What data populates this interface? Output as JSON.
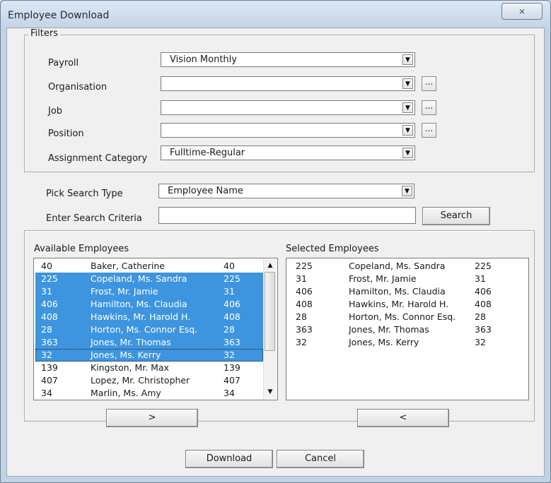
{
  "window": {
    "title": "Employee Download",
    "close_label": "⨯"
  },
  "filters": {
    "legend": "Filters",
    "payroll": {
      "label": "Payroll",
      "value": "Vision Monthly"
    },
    "organisation": {
      "label": "Organisation",
      "value": ""
    },
    "job": {
      "label": "Job",
      "value": ""
    },
    "position": {
      "label": "Position",
      "value": ""
    },
    "assignment_category": {
      "label": "Assignment Category",
      "value": "Fulltime-Regular"
    },
    "ellipsis_label": "..."
  },
  "search": {
    "type_label": "Pick Search Type",
    "type_value": "Employee Name",
    "criteria_label": "Enter Search Criteria",
    "criteria_value": "",
    "button_label": "Search"
  },
  "available": {
    "label": "Available Employees",
    "rows": [
      {
        "id": "40",
        "name": "Baker, Catherine",
        "num": "40",
        "selected": false,
        "focus": false
      },
      {
        "id": "225",
        "name": "Copeland, Ms. Sandra",
        "num": "225",
        "selected": true,
        "focus": false
      },
      {
        "id": "31",
        "name": "Frost, Mr. Jamie",
        "num": "31",
        "selected": true,
        "focus": false
      },
      {
        "id": "406",
        "name": "Hamilton, Ms. Claudia",
        "num": "406",
        "selected": true,
        "focus": false
      },
      {
        "id": "408",
        "name": "Hawkins, Mr. Harold H.",
        "num": "408",
        "selected": true,
        "focus": false
      },
      {
        "id": "28",
        "name": "Horton, Ms. Connor Esq.",
        "num": "28",
        "selected": true,
        "focus": false
      },
      {
        "id": "363",
        "name": "Jones, Mr. Thomas",
        "num": "363",
        "selected": true,
        "focus": false
      },
      {
        "id": "32",
        "name": "Jones, Ms. Kerry",
        "num": "32",
        "selected": true,
        "focus": true
      },
      {
        "id": "139",
        "name": "Kingston, Mr. Max",
        "num": "139",
        "selected": false,
        "focus": false
      },
      {
        "id": "407",
        "name": "Lopez, Mr. Christopher",
        "num": "407",
        "selected": false,
        "focus": false
      },
      {
        "id": "34",
        "name": "Marlin, Ms. Amy",
        "num": "34",
        "selected": false,
        "focus": false
      }
    ]
  },
  "selected": {
    "label": "Selected Employees",
    "rows": [
      {
        "id": "225",
        "name": "Copeland, Ms. Sandra",
        "num": "225"
      },
      {
        "id": "31",
        "name": "Frost, Mr. Jamie",
        "num": "31"
      },
      {
        "id": "406",
        "name": "Hamilton, Ms. Claudia",
        "num": "406"
      },
      {
        "id": "408",
        "name": "Hawkins, Mr. Harold H.",
        "num": "408"
      },
      {
        "id": "28",
        "name": "Horton, Ms. Connor Esq.",
        "num": "28"
      },
      {
        "id": "363",
        "name": "Jones, Mr. Thomas",
        "num": "363"
      },
      {
        "id": "32",
        "name": "Jones, Ms. Kerry",
        "num": "32"
      }
    ]
  },
  "buttons": {
    "add": ">",
    "remove": "<",
    "download": "Download",
    "cancel": "Cancel"
  }
}
